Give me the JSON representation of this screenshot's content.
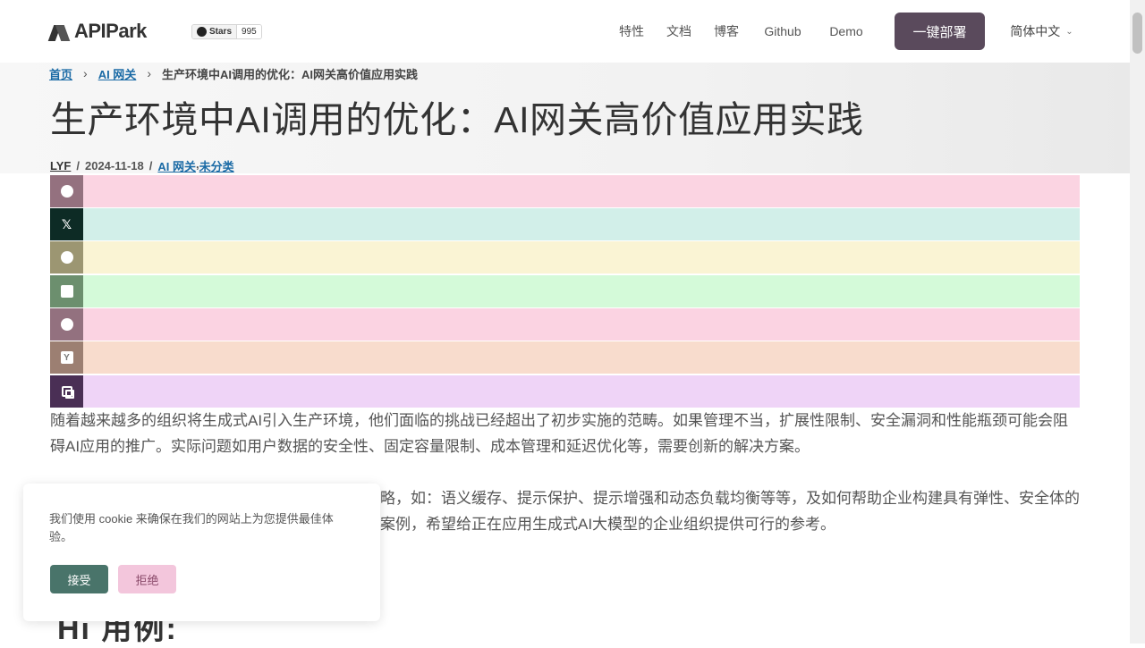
{
  "header": {
    "logo_text": "APIPark",
    "stars_label": "Stars",
    "stars_count": "995",
    "nav": {
      "features": "特性",
      "docs": "文档",
      "blog": "博客",
      "github": "Github",
      "demo": "Demo"
    },
    "deploy_label": "一键部署",
    "language": "简体中文"
  },
  "breadcrumb": {
    "home": "首页",
    "category": "AI 网关",
    "current": "生产环境中AI调用的优化：AI网关高价值应用实践"
  },
  "article": {
    "title": "生产环境中AI调用的优化：AI网关高价值应用实践",
    "author": "LYF",
    "separator": "/",
    "date": "2024-11-18",
    "categories": [
      "AI 网关",
      "未分类"
    ],
    "category_sep": ",",
    "paragraph_1": "随着越来越多的组织将生成式AI引入生产环境，他们面临的挑战已经超出了初步实施的范畴。如果管理不当，扩展性限制、安全漏洞和性能瓶颈可能会阻碍AI应用的推广。实际问题如用户数据的安全性、固定容量限制、成本管理和延迟优化等，需要创新的解决方案。",
    "paragraph_2": "略，如：语义缓存、提示保护、提示增强和动态负载均衡等等，及如何帮助企业构建具有弹性、安全体的案例，希望给正在应用生成式AI大模型的企业组织提供可行的参考。",
    "heading_partial": "Hi 用例:"
  },
  "share": {
    "icons": [
      "facebook-icon",
      "x-icon",
      "pinterest-icon",
      "linkedin-icon",
      "reddit-icon",
      "hackernews-icon",
      "copy-link-icon"
    ],
    "x_glyph": "𝕏",
    "hn_glyph": "Y"
  },
  "cookie": {
    "text": "我们使用 cookie 来确保在我们的网站上为您提供最佳体验。",
    "accept": "接受",
    "reject": "拒绝"
  }
}
